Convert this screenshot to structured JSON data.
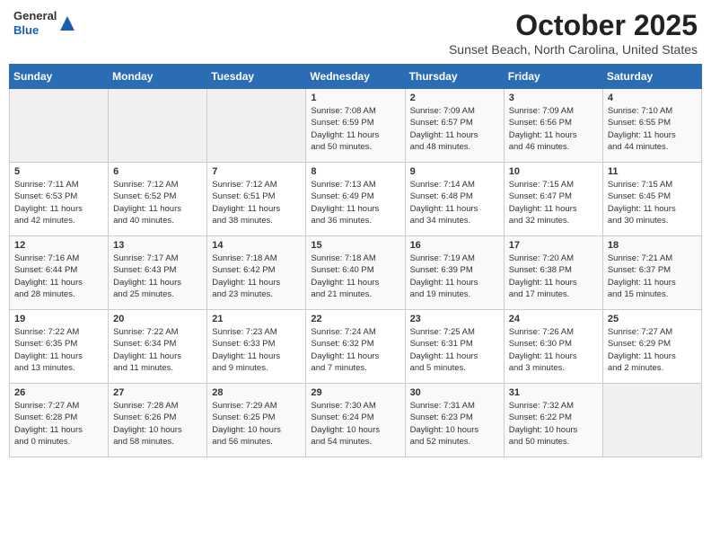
{
  "header": {
    "logo_general": "General",
    "logo_blue": "Blue",
    "month": "October 2025",
    "location": "Sunset Beach, North Carolina, United States"
  },
  "weekdays": [
    "Sunday",
    "Monday",
    "Tuesday",
    "Wednesday",
    "Thursday",
    "Friday",
    "Saturday"
  ],
  "weeks": [
    [
      {
        "day": "",
        "info": ""
      },
      {
        "day": "",
        "info": ""
      },
      {
        "day": "",
        "info": ""
      },
      {
        "day": "1",
        "info": "Sunrise: 7:08 AM\nSunset: 6:59 PM\nDaylight: 11 hours\nand 50 minutes."
      },
      {
        "day": "2",
        "info": "Sunrise: 7:09 AM\nSunset: 6:57 PM\nDaylight: 11 hours\nand 48 minutes."
      },
      {
        "day": "3",
        "info": "Sunrise: 7:09 AM\nSunset: 6:56 PM\nDaylight: 11 hours\nand 46 minutes."
      },
      {
        "day": "4",
        "info": "Sunrise: 7:10 AM\nSunset: 6:55 PM\nDaylight: 11 hours\nand 44 minutes."
      }
    ],
    [
      {
        "day": "5",
        "info": "Sunrise: 7:11 AM\nSunset: 6:53 PM\nDaylight: 11 hours\nand 42 minutes."
      },
      {
        "day": "6",
        "info": "Sunrise: 7:12 AM\nSunset: 6:52 PM\nDaylight: 11 hours\nand 40 minutes."
      },
      {
        "day": "7",
        "info": "Sunrise: 7:12 AM\nSunset: 6:51 PM\nDaylight: 11 hours\nand 38 minutes."
      },
      {
        "day": "8",
        "info": "Sunrise: 7:13 AM\nSunset: 6:49 PM\nDaylight: 11 hours\nand 36 minutes."
      },
      {
        "day": "9",
        "info": "Sunrise: 7:14 AM\nSunset: 6:48 PM\nDaylight: 11 hours\nand 34 minutes."
      },
      {
        "day": "10",
        "info": "Sunrise: 7:15 AM\nSunset: 6:47 PM\nDaylight: 11 hours\nand 32 minutes."
      },
      {
        "day": "11",
        "info": "Sunrise: 7:15 AM\nSunset: 6:45 PM\nDaylight: 11 hours\nand 30 minutes."
      }
    ],
    [
      {
        "day": "12",
        "info": "Sunrise: 7:16 AM\nSunset: 6:44 PM\nDaylight: 11 hours\nand 28 minutes."
      },
      {
        "day": "13",
        "info": "Sunrise: 7:17 AM\nSunset: 6:43 PM\nDaylight: 11 hours\nand 25 minutes."
      },
      {
        "day": "14",
        "info": "Sunrise: 7:18 AM\nSunset: 6:42 PM\nDaylight: 11 hours\nand 23 minutes."
      },
      {
        "day": "15",
        "info": "Sunrise: 7:18 AM\nSunset: 6:40 PM\nDaylight: 11 hours\nand 21 minutes."
      },
      {
        "day": "16",
        "info": "Sunrise: 7:19 AM\nSunset: 6:39 PM\nDaylight: 11 hours\nand 19 minutes."
      },
      {
        "day": "17",
        "info": "Sunrise: 7:20 AM\nSunset: 6:38 PM\nDaylight: 11 hours\nand 17 minutes."
      },
      {
        "day": "18",
        "info": "Sunrise: 7:21 AM\nSunset: 6:37 PM\nDaylight: 11 hours\nand 15 minutes."
      }
    ],
    [
      {
        "day": "19",
        "info": "Sunrise: 7:22 AM\nSunset: 6:35 PM\nDaylight: 11 hours\nand 13 minutes."
      },
      {
        "day": "20",
        "info": "Sunrise: 7:22 AM\nSunset: 6:34 PM\nDaylight: 11 hours\nand 11 minutes."
      },
      {
        "day": "21",
        "info": "Sunrise: 7:23 AM\nSunset: 6:33 PM\nDaylight: 11 hours\nand 9 minutes."
      },
      {
        "day": "22",
        "info": "Sunrise: 7:24 AM\nSunset: 6:32 PM\nDaylight: 11 hours\nand 7 minutes."
      },
      {
        "day": "23",
        "info": "Sunrise: 7:25 AM\nSunset: 6:31 PM\nDaylight: 11 hours\nand 5 minutes."
      },
      {
        "day": "24",
        "info": "Sunrise: 7:26 AM\nSunset: 6:30 PM\nDaylight: 11 hours\nand 3 minutes."
      },
      {
        "day": "25",
        "info": "Sunrise: 7:27 AM\nSunset: 6:29 PM\nDaylight: 11 hours\nand 2 minutes."
      }
    ],
    [
      {
        "day": "26",
        "info": "Sunrise: 7:27 AM\nSunset: 6:28 PM\nDaylight: 11 hours\nand 0 minutes."
      },
      {
        "day": "27",
        "info": "Sunrise: 7:28 AM\nSunset: 6:26 PM\nDaylight: 10 hours\nand 58 minutes."
      },
      {
        "day": "28",
        "info": "Sunrise: 7:29 AM\nSunset: 6:25 PM\nDaylight: 10 hours\nand 56 minutes."
      },
      {
        "day": "29",
        "info": "Sunrise: 7:30 AM\nSunset: 6:24 PM\nDaylight: 10 hours\nand 54 minutes."
      },
      {
        "day": "30",
        "info": "Sunrise: 7:31 AM\nSunset: 6:23 PM\nDaylight: 10 hours\nand 52 minutes."
      },
      {
        "day": "31",
        "info": "Sunrise: 7:32 AM\nSunset: 6:22 PM\nDaylight: 10 hours\nand 50 minutes."
      },
      {
        "day": "",
        "info": ""
      }
    ]
  ]
}
